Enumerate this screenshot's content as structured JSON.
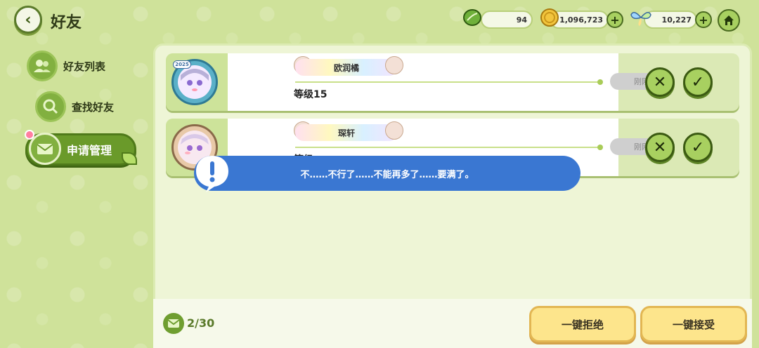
{
  "header": {
    "back_icon": "chevron-left",
    "title": "好友"
  },
  "resources": [
    {
      "name": "leaf-currency",
      "value": "94",
      "icon": "leaf-icon",
      "has_plus": false
    },
    {
      "name": "coin-currency",
      "value": "1,096,723",
      "icon": "coin-icon",
      "has_plus": true
    },
    {
      "name": "butterfly-currency",
      "value": "10,227",
      "icon": "butterfly-icon",
      "has_plus": true
    }
  ],
  "home_icon": "home-icon",
  "sidebar": {
    "items": [
      {
        "label": "好友列表",
        "icon": "friends-icon",
        "active": false
      },
      {
        "label": "查找好友",
        "icon": "search-icon",
        "active": false
      },
      {
        "label": "申请管理",
        "icon": "mail-icon",
        "active": true
      }
    ]
  },
  "requests": [
    {
      "name": "欧润橘",
      "level": "等级15",
      "time": "刚刚",
      "badge": "2025"
    },
    {
      "name": "琛轩",
      "level": "等级",
      "time": "刚刚",
      "badge": ""
    }
  ],
  "toast": {
    "message": "不……不行了……不能再多了……要满了。",
    "icon": "exclamation-icon"
  },
  "footer": {
    "count": "2/30",
    "reject_all_label": "一键拒绝",
    "accept_all_label": "一键接受"
  },
  "colors": {
    "background": "#cfe29a",
    "accent_green": "#a8d060",
    "toast_blue": "#3a77d2",
    "button_yellow": "#fde58c"
  }
}
